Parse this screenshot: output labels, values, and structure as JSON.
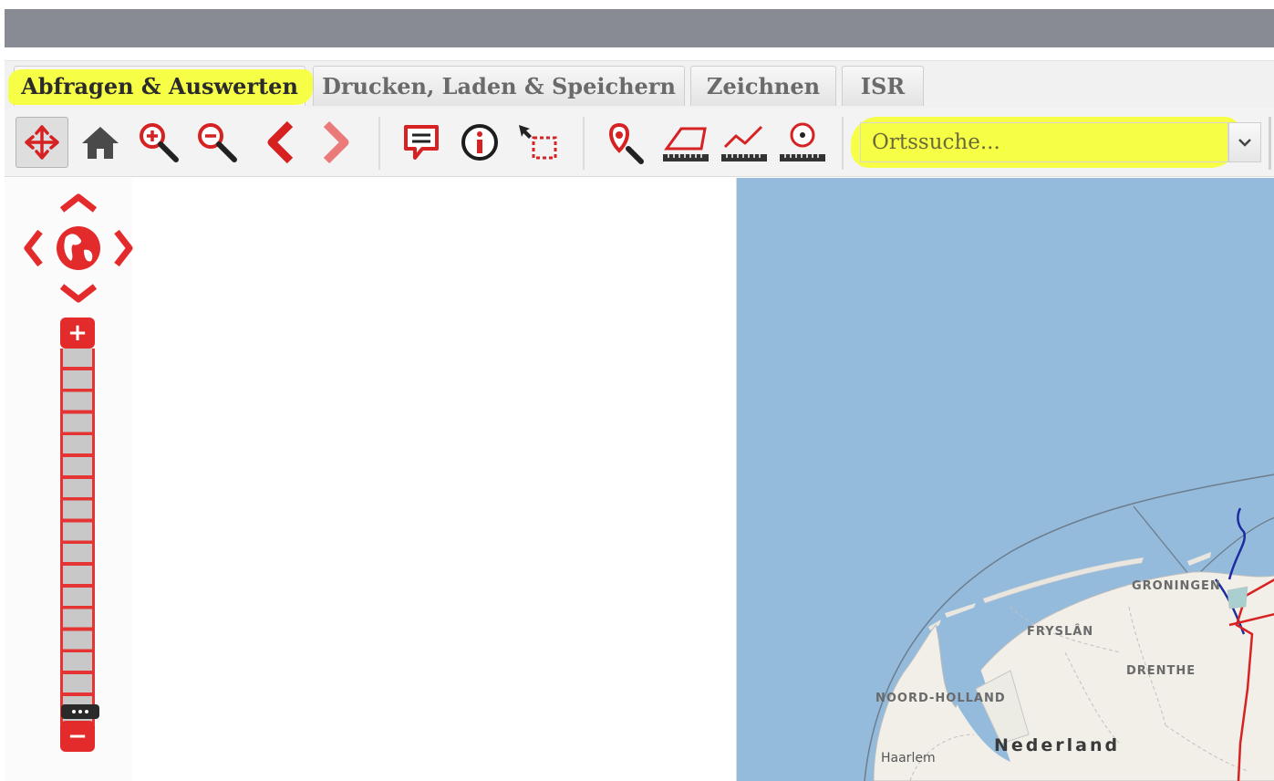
{
  "tabs": [
    {
      "label": "Abfragen & Auswerten",
      "active": true,
      "highlighted": true
    },
    {
      "label": "Drucken, Laden & Speichern",
      "active": false
    },
    {
      "label": "Zeichnen",
      "active": false
    },
    {
      "label": "ISR",
      "active": false
    }
  ],
  "toolbar": {
    "tools": [
      {
        "icon": "pan-icon",
        "pressed": true
      },
      {
        "icon": "home-icon"
      },
      {
        "icon": "zoom-in-icon"
      },
      {
        "icon": "zoom-out-icon"
      },
      {
        "icon": "back-arrow-icon"
      },
      {
        "icon": "forward-arrow-icon"
      },
      {
        "icon": "comment-icon"
      },
      {
        "icon": "info-icon"
      },
      {
        "icon": "select-rectangle-icon"
      },
      {
        "icon": "locate-icon"
      },
      {
        "icon": "measure-area-icon"
      },
      {
        "icon": "measure-line-icon"
      },
      {
        "icon": "measure-circle-icon"
      }
    ]
  },
  "search": {
    "placeholder": "Ortssuche...",
    "value": ""
  },
  "map": {
    "labels": {
      "groningen": "GRONINGEN",
      "fryslan": "FRYSLÂN",
      "drenthe": "DRENTHE",
      "noord_holland": "NOORD-HOLLAND",
      "nederland": "Nederland",
      "haarlem": "Haarlem"
    }
  },
  "zoom": {
    "plus_label": "+",
    "minus_label": "−",
    "level_fraction": 0.06
  },
  "colors": {
    "accent": "#e32b2b",
    "highlight": "#f6ff3b",
    "sea": "#94bbdc",
    "land": "#f1efe8",
    "titlebar": "#888b94"
  }
}
